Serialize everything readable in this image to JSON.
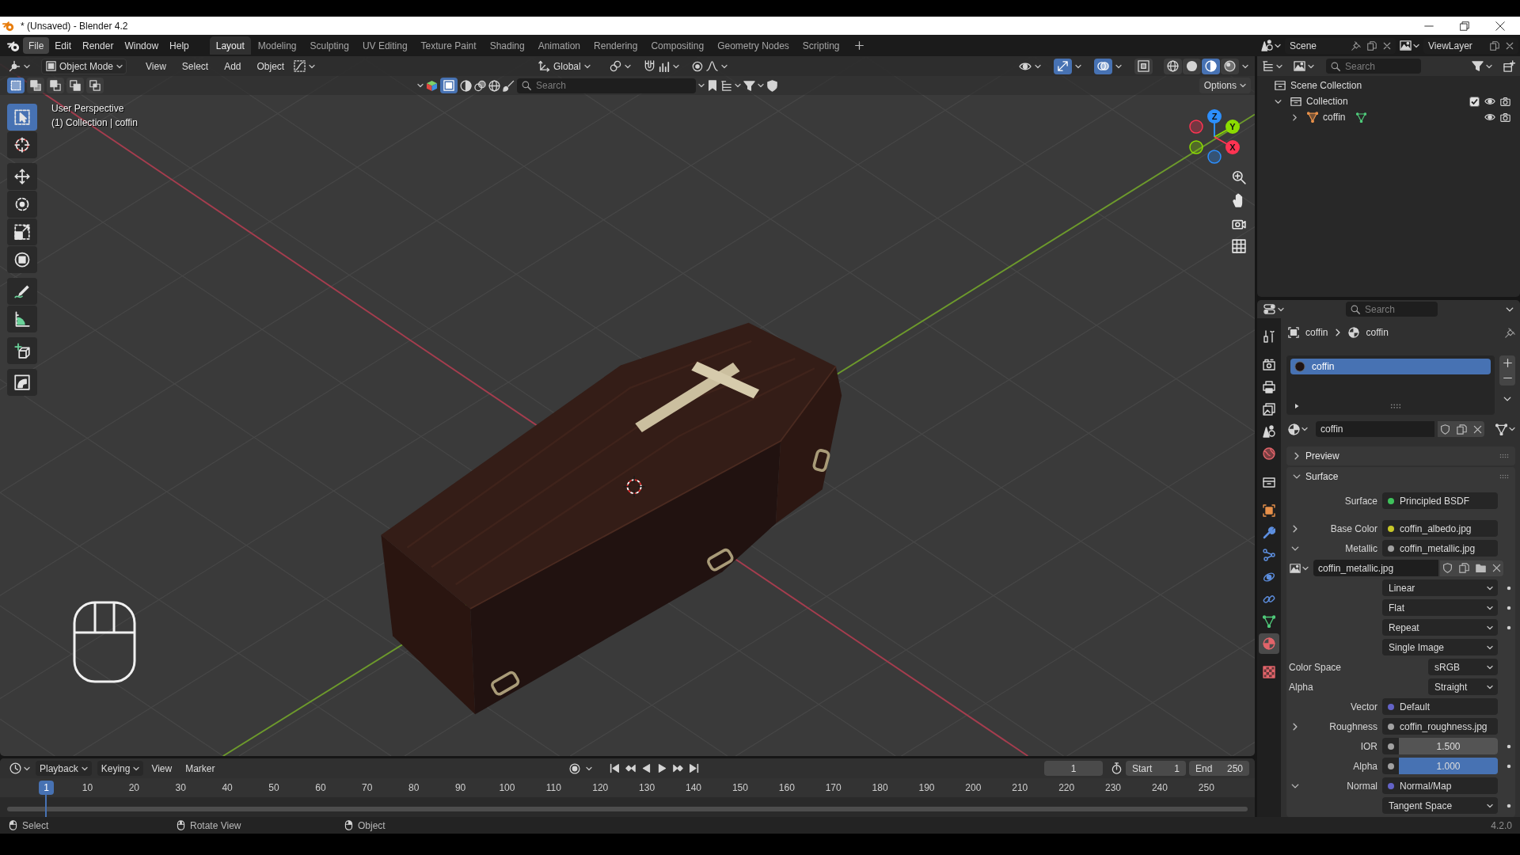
{
  "window": {
    "title": "* (Unsaved) - Blender 4.2"
  },
  "menu": [
    {
      "label": "File",
      "selected": true
    },
    {
      "label": "Edit",
      "selected": false
    },
    {
      "label": "Render",
      "selected": false
    },
    {
      "label": "Window",
      "selected": false
    },
    {
      "label": "Help",
      "selected": false
    }
  ],
  "workspaces": [
    {
      "label": "Layout",
      "selected": true
    },
    {
      "label": "Modeling",
      "selected": false
    },
    {
      "label": "Sculpting",
      "selected": false
    },
    {
      "label": "UV Editing",
      "selected": false
    },
    {
      "label": "Texture Paint",
      "selected": false
    },
    {
      "label": "Shading",
      "selected": false
    },
    {
      "label": "Animation",
      "selected": false
    },
    {
      "label": "Rendering",
      "selected": false
    },
    {
      "label": "Compositing",
      "selected": false
    },
    {
      "label": "Geometry Nodes",
      "selected": false
    },
    {
      "label": "Scripting",
      "selected": false
    }
  ],
  "scene": "Scene",
  "view_layer": "ViewLayer",
  "viewport": {
    "mode": "Object Mode",
    "menus": [
      "View",
      "Select",
      "Add",
      "Object"
    ],
    "orientation": "Global",
    "toggles": [
      {
        "kind": "gizmos",
        "on": true
      },
      {
        "kind": "overlays",
        "on": true
      },
      {
        "kind": "xray",
        "on": false
      }
    ],
    "shading": [
      {
        "kind": "wireframe",
        "selected": false
      },
      {
        "kind": "solid",
        "selected": false
      },
      {
        "kind": "material",
        "selected": true
      },
      {
        "kind": "rendered",
        "selected": false
      }
    ],
    "select_modes": [
      {
        "kind": "set",
        "selected": true
      },
      {
        "kind": "extend",
        "selected": false
      },
      {
        "kind": "subtract",
        "selected": false
      },
      {
        "kind": "invert",
        "selected": false
      },
      {
        "kind": "intersect",
        "selected": false
      }
    ],
    "search_placeholder": "Search",
    "options": "Options",
    "overlay_text": [
      "User Perspective",
      "(1) Collection | coffin"
    ],
    "tools": [
      {
        "kind": "select",
        "selected": true
      },
      {
        "kind": "cursor",
        "selected": false
      },
      {
        "kind": "move",
        "selected": false
      },
      {
        "kind": "rotate",
        "selected": false
      },
      {
        "kind": "scale",
        "selected": false
      },
      {
        "kind": "transform",
        "selected": false
      },
      {
        "kind": "annotate",
        "selected": false
      },
      {
        "kind": "measure",
        "selected": false
      },
      {
        "kind": "add_cube",
        "selected": false
      },
      {
        "kind": "bend",
        "selected": false
      }
    ],
    "gizmo": [
      {
        "label": "Z",
        "color": "#2c8fff"
      },
      {
        "label": "Y",
        "color": "#8bdc00"
      },
      {
        "label": "X",
        "color": "#ff3352"
      }
    ]
  },
  "outliner": {
    "search_placeholder": "Search",
    "tree": [
      {
        "label": "Scene Collection",
        "kind": "scene_collection",
        "children": [
          {
            "label": "Collection",
            "kind": "collection",
            "expanded": true,
            "checked": true,
            "children": [
              {
                "label": "coffin",
                "kind": "mesh_object",
                "expanded": false
              }
            ]
          }
        ]
      }
    ]
  },
  "properties": {
    "search_placeholder": "Search",
    "tabs": [
      {
        "kind": "tool",
        "selected": false
      },
      {
        "kind": "render",
        "selected": false
      },
      {
        "kind": "output",
        "selected": false
      },
      {
        "kind": "view_layer",
        "selected": false
      },
      {
        "kind": "scene",
        "selected": false
      },
      {
        "kind": "world",
        "selected": false
      },
      {
        "kind": "collection",
        "selected": false
      },
      {
        "kind": "object",
        "selected": false
      },
      {
        "kind": "modifiers",
        "selected": false
      },
      {
        "kind": "particles",
        "selected": false
      },
      {
        "kind": "physics",
        "selected": false
      },
      {
        "kind": "constraints",
        "selected": false
      },
      {
        "kind": "data",
        "selected": false
      },
      {
        "kind": "material",
        "selected": true
      },
      {
        "kind": "texture",
        "selected": false
      }
    ],
    "breadcrumb": [
      "coffin",
      "coffin"
    ],
    "slots": [
      {
        "label": "coffin",
        "selected": true
      }
    ],
    "material": "coffin",
    "panels": [
      {
        "title": "Preview",
        "expanded": false
      },
      {
        "title": "Surface",
        "expanded": true,
        "rows": [
          {
            "kind": "socket",
            "label": "Surface",
            "value": "Principled BSDF",
            "color": "#3fc15b"
          },
          {
            "kind": "socket",
            "label": "Base Color",
            "value": "coffin_albedo.jpg",
            "color": "#c7c729",
            "expanded": false
          },
          {
            "kind": "socket",
            "label": "Metallic",
            "value": "coffin_metallic.jpg",
            "color": "#a1a1a1",
            "expanded": true
          },
          {
            "kind": "image",
            "value": "coffin_metallic.jpg"
          },
          {
            "kind": "dropdown",
            "value": "Linear",
            "decorator": true
          },
          {
            "kind": "dropdown",
            "value": "Flat",
            "decorator": true
          },
          {
            "kind": "dropdown",
            "value": "Repeat",
            "decorator": true
          },
          {
            "kind": "dropdown",
            "value": "Single Image",
            "decorator": false
          },
          {
            "kind": "enum",
            "label": "Color Space",
            "value": "sRGB"
          },
          {
            "kind": "enum",
            "label": "Alpha",
            "value": "Straight"
          },
          {
            "kind": "socket",
            "label": "Vector",
            "value": "Default",
            "color": "#6363c7"
          },
          {
            "kind": "socket",
            "label": "Roughness",
            "value": "coffin_roughness.jpg",
            "color": "#a1a1a1",
            "expanded": false
          },
          {
            "kind": "number",
            "label": "IOR",
            "value": "1.500",
            "color": "#a1a1a1",
            "decorator": true
          },
          {
            "kind": "slider",
            "label": "Alpha",
            "value": "1.000",
            "color": "#a1a1a1",
            "level": 1,
            "decorator": true
          },
          {
            "kind": "socket",
            "label": "Normal",
            "value": "Normal/Map",
            "color": "#6363c7",
            "expanded": true
          },
          {
            "kind": "dropdown",
            "value": "Tangent Space",
            "decorator": true
          }
        ]
      }
    ]
  },
  "timeline": {
    "menus": [
      {
        "label": "Playback",
        "kind": "dropdown"
      },
      {
        "label": "Keying",
        "kind": "dropdown"
      },
      {
        "label": "View",
        "kind": "menu"
      },
      {
        "label": "Marker",
        "kind": "menu"
      }
    ],
    "current_frame": "1",
    "start_label": "Start",
    "start": "1",
    "end_label": "End",
    "end": "250",
    "playhead": "1",
    "ruler": [
      "10",
      "20",
      "30",
      "40",
      "50",
      "60",
      "70",
      "80",
      "90",
      "100",
      "110",
      "120",
      "130",
      "140",
      "150",
      "160",
      "170",
      "180",
      "190",
      "200",
      "210",
      "220",
      "230",
      "240",
      "250"
    ]
  },
  "status_bar": {
    "hints": [
      {
        "kind": "left",
        "label": "Select"
      },
      {
        "kind": "middle",
        "label": "Rotate View"
      },
      {
        "kind": "right",
        "label": "Object"
      }
    ],
    "version": "4.2.0"
  }
}
